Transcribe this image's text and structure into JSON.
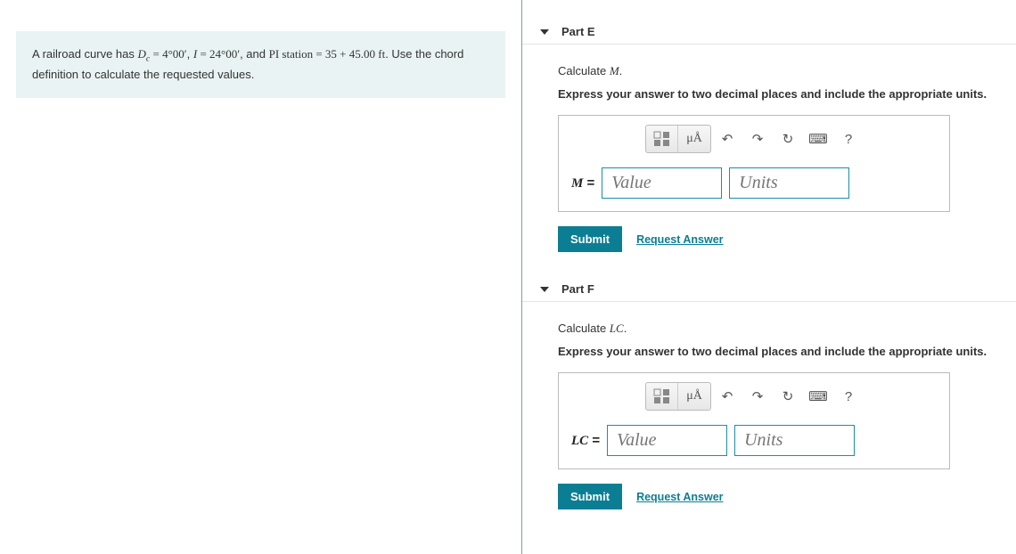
{
  "problem": {
    "prefix": "A railroad curve has ",
    "d_label": "D",
    "d_sub": "c",
    "d_val": " = 4°00′",
    "sep1": ", ",
    "i_label": "I",
    "i_val": " = 24°00′",
    "sep2": ", and ",
    "pi_label": "PI station",
    "pi_val": " = 35 + 45.00 ft",
    "suffix": ". Use the chord definition to calculate the requested values."
  },
  "parts": [
    {
      "id": "E",
      "title": "Part E",
      "calc_prefix": "Calculate ",
      "calc_var": "M",
      "calc_suffix": ".",
      "hint": "Express your answer to two decimal places and include the appropriate units.",
      "var_label": "M",
      "eq": " = ",
      "value_ph": "Value",
      "units_ph": "Units",
      "submit": "Submit",
      "request": "Request Answer",
      "toolbar": {
        "units_btn": "μÅ",
        "help": "?"
      }
    },
    {
      "id": "F",
      "title": "Part F",
      "calc_prefix": "Calculate ",
      "calc_var": "LC",
      "calc_suffix": ".",
      "hint": "Express your answer to two decimal places and include the appropriate units.",
      "var_label": "LC",
      "eq": " = ",
      "value_ph": "Value",
      "units_ph": "Units",
      "submit": "Submit",
      "request": "Request Answer",
      "toolbar": {
        "units_btn": "μÅ",
        "help": "?"
      }
    }
  ]
}
